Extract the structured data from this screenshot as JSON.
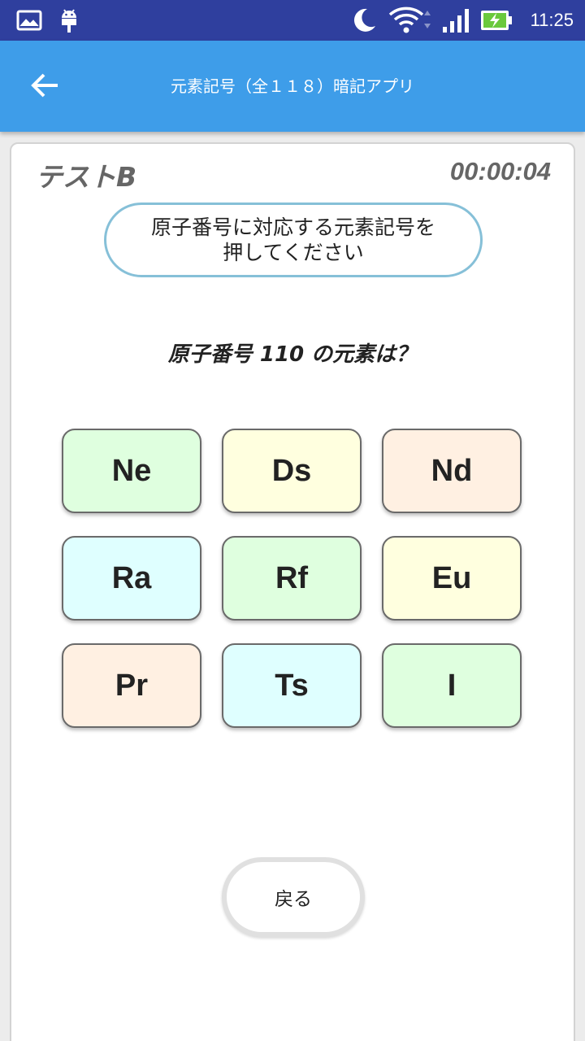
{
  "status_bar": {
    "time": "11:25",
    "icons": [
      "image-icon",
      "android-icon",
      "moon-icon",
      "wifi-icon",
      "signal-icon",
      "battery-charging-icon"
    ],
    "battery_color": "#6ac93c"
  },
  "app_bar": {
    "title": "元素記号（全１１８）暗記アプリ",
    "back_icon": "arrow-left-icon",
    "color": "#3e9de9"
  },
  "quiz": {
    "test_name": "テストB",
    "timer": "00:00:04",
    "instruction_line1": "原子番号に対応する元素記号を",
    "instruction_line2": "押してください",
    "question": "原子番号 110 の元素は？",
    "choices": [
      {
        "label": "Ne",
        "color": "#dfffdf"
      },
      {
        "label": "Ds",
        "color": "#ffffdf"
      },
      {
        "label": "Nd",
        "color": "#fff0e2"
      },
      {
        "label": "Ra",
        "color": "#dfffff"
      },
      {
        "label": "Rf",
        "color": "#dfffdf"
      },
      {
        "label": "Eu",
        "color": "#ffffdf"
      },
      {
        "label": "Pr",
        "color": "#fff0e2"
      },
      {
        "label": "Ts",
        "color": "#dfffff"
      },
      {
        "label": "I",
        "color": "#dfffdf"
      }
    ],
    "back_button": "戻る"
  }
}
